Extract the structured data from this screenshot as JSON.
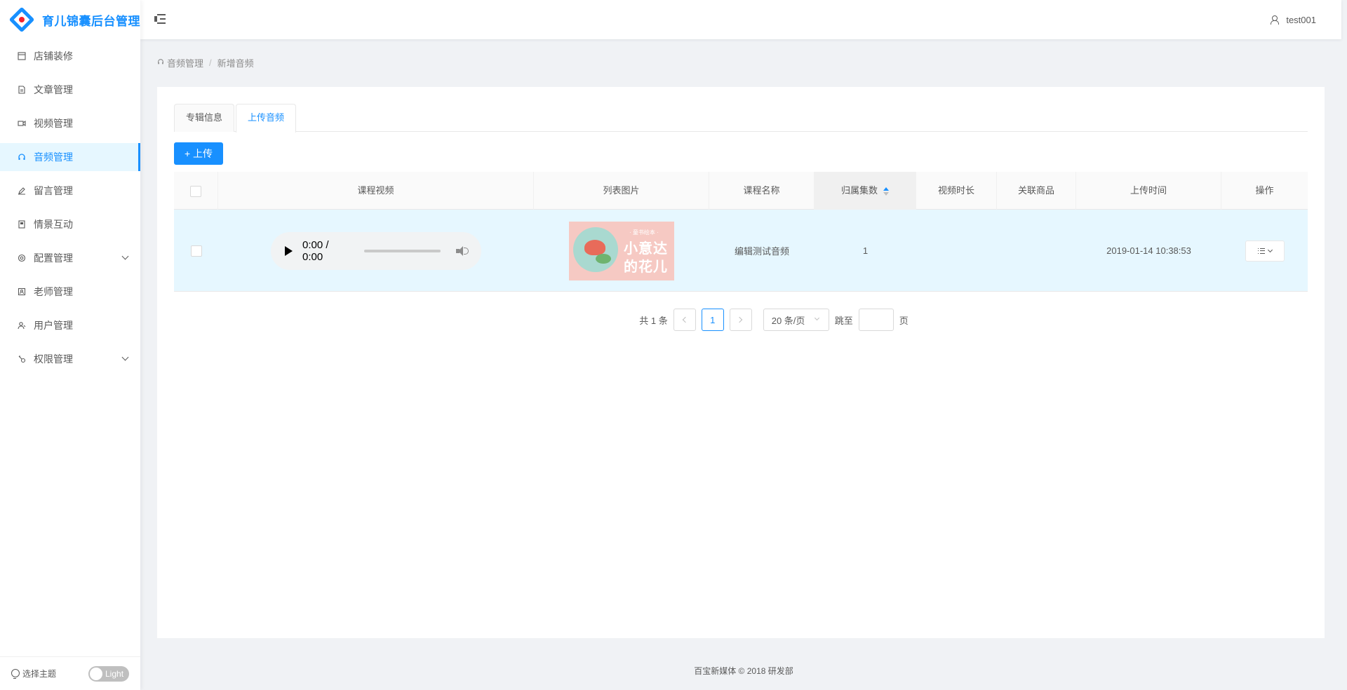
{
  "app": {
    "title": "育儿锦囊后台管理"
  },
  "sidebar": {
    "items": [
      {
        "label": "店铺装修",
        "icon": "shop-icon"
      },
      {
        "label": "文章管理",
        "icon": "file-icon"
      },
      {
        "label": "视频管理",
        "icon": "video-icon"
      },
      {
        "label": "音频管理",
        "icon": "audio-icon",
        "active": true
      },
      {
        "label": "留言管理",
        "icon": "edit-icon"
      },
      {
        "label": "情景互动",
        "icon": "book-icon"
      },
      {
        "label": "配置管理",
        "icon": "setting-icon",
        "expandable": true
      },
      {
        "label": "老师管理",
        "icon": "contacts-icon"
      },
      {
        "label": "用户管理",
        "icon": "user-icon"
      },
      {
        "label": "权限管理",
        "icon": "key-icon",
        "expandable": true
      }
    ],
    "theme_label": "选择主题",
    "theme_toggle": "Light"
  },
  "header": {
    "username": "test001"
  },
  "breadcrumb": {
    "items": [
      "音频管理",
      "新增音频"
    ],
    "separator": "/"
  },
  "tabs": [
    {
      "label": "专辑信息"
    },
    {
      "label": "上传音频",
      "active": true
    }
  ],
  "toolbar": {
    "upload_label": "+ 上传"
  },
  "table": {
    "columns": [
      "课程视频",
      "列表图片",
      "课程名称",
      "归属集数",
      "视频时长",
      "关联商品",
      "上传时间",
      "操作"
    ],
    "rows": [
      {
        "audio_time": "0:00 / 0:00",
        "cover": {
          "tag": "· 童书绘本 ·",
          "line1": "小意达",
          "line2": "的花儿"
        },
        "name": "编辑测试音频",
        "episode": "1",
        "duration": "",
        "product": "",
        "upload_time": "2019-01-14 10:38:53"
      }
    ]
  },
  "pagination": {
    "total": "共 1 条",
    "current_page": "1",
    "page_size": "20 条/页",
    "jump_label": "跳至",
    "page_unit": "页"
  },
  "footer": {
    "text": "百宝新媒体 © 2018 研发部"
  },
  "colors": {
    "primary": "#1890ff",
    "selected_row": "#e6f7ff"
  }
}
